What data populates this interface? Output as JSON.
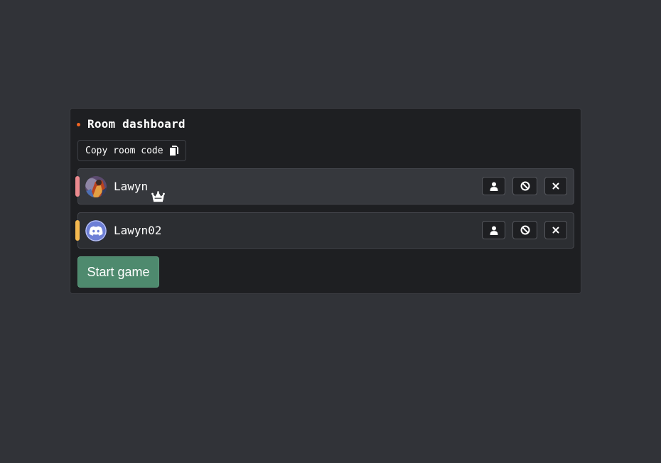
{
  "dashboard": {
    "title": "Room dashboard",
    "status_dot_color": "#f26522",
    "copy_button_label": "Copy room code",
    "copy_icon": "copy-icon",
    "start_button_label": "Start game",
    "start_button_color": "#4e8a6e"
  },
  "players": [
    {
      "name": "Lawyn",
      "is_host": true,
      "host_icon": "crown-icon",
      "color": "#ec8a8f",
      "avatar": "photo-avatar",
      "actions": [
        "user-icon",
        "ban-icon",
        "close-icon"
      ]
    },
    {
      "name": "Lawyn02",
      "is_host": false,
      "color": "#f5b94f",
      "avatar": "discord-default-avatar",
      "avatar_color": "#6d7fd6",
      "actions": [
        "user-icon",
        "ban-icon",
        "close-icon"
      ]
    }
  ]
}
